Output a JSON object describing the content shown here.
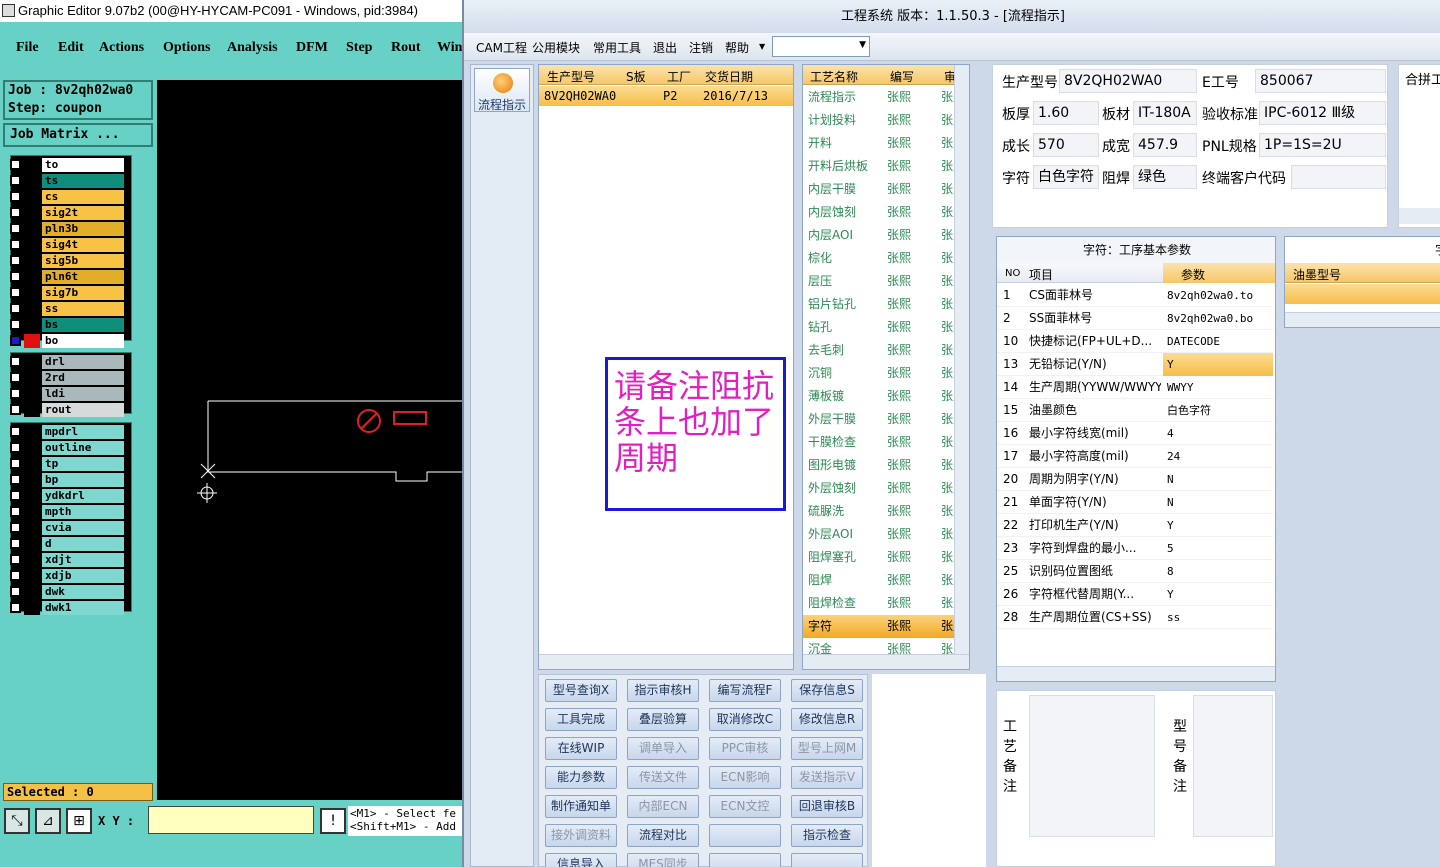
{
  "genesis": {
    "title": "Graphic Editor 9.07b2 (00@HY-HYCAM-PC091 - Windows, pid:3984)",
    "menu": [
      "File",
      "Edit",
      "Actions",
      "Options",
      "Analysis",
      "DFM",
      "Step",
      "Rout",
      "Win"
    ],
    "job": "Job : 8v2qh02wa0",
    "step": "Step: coupon",
    "job_matrix": "Job Matrix ...",
    "layers_group1": [
      {
        "name": "to",
        "color": "#ffffff"
      },
      {
        "name": "ts",
        "color": "#0f8f7a"
      },
      {
        "name": "cs",
        "color": "#f7c246"
      },
      {
        "name": "sig2t",
        "color": "#f7c246"
      },
      {
        "name": "pln3b",
        "color": "#e2ad2b"
      },
      {
        "name": "sig4t",
        "color": "#f7c246"
      },
      {
        "name": "sig5b",
        "color": "#f7c246"
      },
      {
        "name": "pln6t",
        "color": "#e2ad2b"
      },
      {
        "name": "sig7b",
        "color": "#f7c246"
      },
      {
        "name": "ss",
        "color": "#f7c246"
      },
      {
        "name": "bs",
        "color": "#0f8f7a"
      },
      {
        "name": "bo",
        "color": "#ffffff"
      }
    ],
    "layers_group2": [
      {
        "name": "drl",
        "color": "#a9b8bb"
      },
      {
        "name": "2rd",
        "color": "#a9b8bb"
      },
      {
        "name": "ldi",
        "color": "#a9b8bb"
      },
      {
        "name": "rout",
        "color": "#d7dada"
      }
    ],
    "layers_group3": [
      {
        "name": "mpdrl",
        "color": "#7fd8cf"
      },
      {
        "name": "outline",
        "color": "#7fd8cf"
      },
      {
        "name": "tp",
        "color": "#7fd8cf"
      },
      {
        "name": "bp",
        "color": "#7fd8cf"
      },
      {
        "name": "ydkdrl",
        "color": "#7fd8cf"
      },
      {
        "name": "mpth",
        "color": "#7fd8cf"
      },
      {
        "name": "cvia",
        "color": "#7fd8cf"
      },
      {
        "name": "d",
        "color": "#7fd8cf"
      },
      {
        "name": "xdjt",
        "color": "#7fd8cf"
      },
      {
        "name": "xdjb",
        "color": "#7fd8cf"
      },
      {
        "name": "dwk",
        "color": "#7fd8cf"
      },
      {
        "name": "dwk1",
        "color": "#7fd8cf"
      }
    ],
    "selected": "Selected : 0",
    "xy_label": "X Y :",
    "hint_line1": "<M1> - Select fe",
    "hint_line2": "<Shift+M1> - Add"
  },
  "cam": {
    "title": "工程系统   版本：1.1.50.3 - [流程指示]",
    "menu": [
      "CAM工程",
      "公用模块",
      "常用工具",
      "退出",
      "注销",
      "帮助"
    ],
    "nav_label": "流程指示",
    "orders_headers": [
      "生产型号",
      "S板",
      "工厂",
      "交货日期"
    ],
    "orders_rows": [
      [
        "8V2QH02WA0",
        "",
        "P2",
        "2016/7/13"
      ]
    ],
    "note_text": "请备注阻抗条上也加了周期",
    "process_headers": [
      "工艺名称",
      "编写",
      "审核"
    ],
    "processes": [
      [
        "流程指示",
        "张熙",
        "张熙"
      ],
      [
        "计划投料",
        "张熙",
        "张熙"
      ],
      [
        "开料",
        "张熙",
        "张熙"
      ],
      [
        "开料后烘板",
        "张熙",
        "张熙"
      ],
      [
        "内层干膜",
        "张熙",
        "张熙"
      ],
      [
        "内层蚀刻",
        "张熙",
        "张熙"
      ],
      [
        "内层AOI",
        "张熙",
        "张熙"
      ],
      [
        "棕化",
        "张熙",
        "张熙"
      ],
      [
        "层压",
        "张熙",
        "张熙"
      ],
      [
        "铝片钻孔",
        "张熙",
        "张熙"
      ],
      [
        "钻孔",
        "张熙",
        "张熙"
      ],
      [
        "去毛刺",
        "张熙",
        "张熙"
      ],
      [
        "沉铜",
        "张熙",
        "张熙"
      ],
      [
        "薄板镀",
        "张熙",
        "张熙"
      ],
      [
        "外层干膜",
        "张熙",
        "张熙"
      ],
      [
        "干膜检查",
        "张熙",
        "张熙"
      ],
      [
        "图形电镀",
        "张熙",
        "张熙"
      ],
      [
        "外层蚀刻",
        "张熙",
        "张熙"
      ],
      [
        "硫脲洗",
        "张熙",
        "张熙"
      ],
      [
        "外层AOI",
        "张熙",
        "张熙"
      ],
      [
        "阻焊塞孔",
        "张熙",
        "张熙"
      ],
      [
        "阻焊",
        "张熙",
        "张熙"
      ],
      [
        "阻焊检查",
        "张熙",
        "张熙"
      ],
      [
        "字符",
        "张熙",
        "张熙"
      ],
      [
        "沉金",
        "张熙",
        "张熙"
      ]
    ],
    "highlight_process_index": 23,
    "info": {
      "model_label": "生产型号",
      "model": "8V2QH02WA0",
      "eno_label": "E工号",
      "eno": "850067",
      "thick_label": "板厚",
      "thick": "1.60",
      "mat_label": "板材",
      "mat": "IT-180A",
      "std_label": "验收标准",
      "std": "IPC-6012 Ⅲ级",
      "len_label": "成长",
      "len": "570",
      "wid_label": "成宽",
      "wid": "457.9",
      "pnl_label": "PNL规格",
      "pnl": "1P=1S=2U",
      "char_label": "字符",
      "char": "白色字符",
      "mask_label": "阻焊",
      "mask": "绿色",
      "cust_label": "终端客户代码",
      "cust": "",
      "combine_label": "合拼工"
    },
    "params_title": "字符：工序基本参数",
    "params_headers": [
      "NO",
      "项目",
      "参数"
    ],
    "params": [
      [
        "1",
        "CS面菲林号",
        "8v2qh02wa0.to"
      ],
      [
        "2",
        "SS面菲林号",
        "8v2qh02wa0.bo"
      ],
      [
        "10",
        "快捷标记(FP+UL+D...",
        "DATECODE"
      ],
      [
        "13",
        "无铅标记(Y/N)",
        "Y"
      ],
      [
        "14",
        "生产周期(YYWW/WWYY)",
        "WWYY"
      ],
      [
        "15",
        "油墨颜色",
        "白色字符"
      ],
      [
        "16",
        "最小字符线宽(mil)",
        "4"
      ],
      [
        "17",
        "最小字符高度(mil)",
        "24"
      ],
      [
        "20",
        "周期为阴字(Y/N)",
        "N"
      ],
      [
        "21",
        "单面字符(Y/N)",
        "N"
      ],
      [
        "22",
        "打印机生产(Y/N)",
        "Y"
      ],
      [
        "23",
        "字符到焊盘的最小...",
        "5"
      ],
      [
        "25",
        "识别码位置图纸",
        "8"
      ],
      [
        "26",
        "字符框代替周期(Y...",
        "Y"
      ],
      [
        "28",
        "生产周期位置(CS+SS)",
        "ss"
      ]
    ],
    "highlight_param_index": 3,
    "ink_header": "油墨型号",
    "right_title_partial": "字",
    "remark_process_label": "工艺备注",
    "remark_model_label": "型号备注",
    "buttons": [
      [
        "型号查询X",
        "指示审核H",
        "编写流程F",
        "保存信息S"
      ],
      [
        "工具完成",
        "叠层验算",
        "取消修改C",
        "修改信息R"
      ],
      [
        "在线WIP",
        "调单导入",
        "PPC审核",
        "型号上网M"
      ],
      [
        "能力参数",
        "传送文件",
        "ECN影响",
        "发送指示V"
      ],
      [
        "制作通知单",
        "内部ECN",
        "ECN文控",
        "回退审核B"
      ],
      [
        "接外调资料",
        "流程对比",
        "",
        "指示检查"
      ],
      [
        "信息导入",
        "MES同步",
        "",
        ""
      ]
    ],
    "disabled_buttons": [
      "调单导入",
      "PPC审核",
      "型号上网M",
      "传送文件",
      "ECN影响",
      "发送指示V",
      "内部ECN",
      "ECN文控",
      "接外调资料",
      "MES同步"
    ]
  }
}
